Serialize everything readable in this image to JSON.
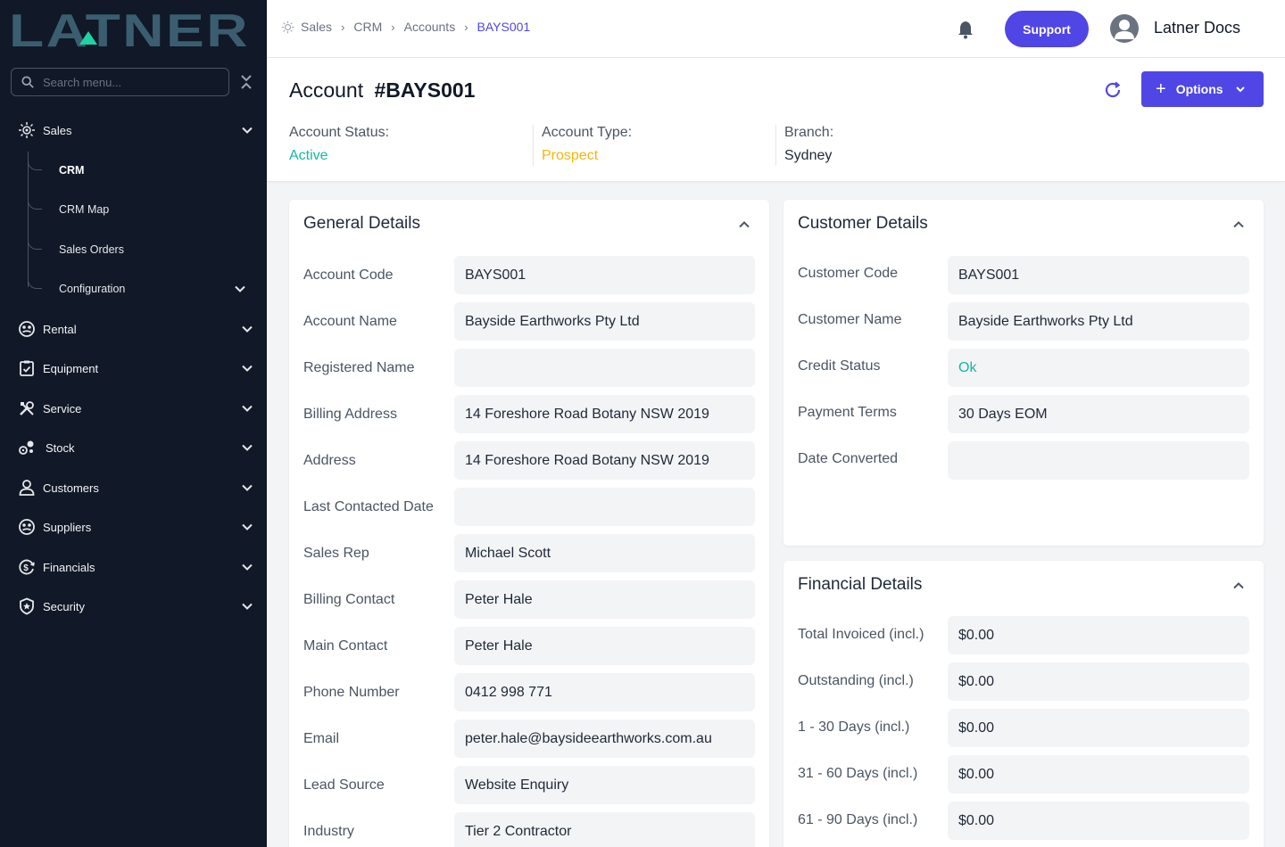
{
  "app": {
    "logo_text": "LATNER",
    "search_placeholder": "Search menu..."
  },
  "colors": {
    "accent": "#4f46e5",
    "active": "#14b8a6",
    "prospect": "#f5b50a",
    "sidebar_bg": "#111827"
  },
  "sidebar": {
    "sales": {
      "label": "Sales",
      "icon": "sales-icon"
    },
    "sales_sub": [
      {
        "label": "CRM",
        "active": true
      },
      {
        "label": "CRM Map"
      },
      {
        "label": "Sales Orders"
      },
      {
        "label": "Configuration"
      }
    ],
    "items": [
      {
        "label": "Rental",
        "icon": "rental-icon"
      },
      {
        "label": "Equipment",
        "icon": "clipboard-check-icon"
      },
      {
        "label": "Service",
        "icon": "tools-icon"
      },
      {
        "label": "Stock",
        "icon": "stock-icon"
      },
      {
        "label": "Customers",
        "icon": "user-icon"
      },
      {
        "label": "Suppliers",
        "icon": "suppliers-icon"
      },
      {
        "label": "Financials",
        "icon": "financials-icon"
      },
      {
        "label": "Security",
        "icon": "shield-icon"
      }
    ]
  },
  "header": {
    "breadcrumb": [
      "Sales",
      "CRM",
      "Accounts",
      "BAYS001"
    ],
    "support_label": "Support",
    "user_name": "Latner Docs"
  },
  "account": {
    "title_prefix": "Account",
    "title_id": "#BAYS001",
    "options_label": "Options",
    "status_label": "Account Status:",
    "status_value": "Active",
    "type_label": "Account Type:",
    "type_value": "Prospect",
    "branch_label": "Branch:",
    "branch_value": "Sydney"
  },
  "general_details": {
    "title": "General Details",
    "rows": [
      {
        "label": "Account Code",
        "value": "BAYS001"
      },
      {
        "label": "Account Name",
        "value": "Bayside Earthworks Pty Ltd"
      },
      {
        "label": "Registered Name",
        "value": ""
      },
      {
        "label": "Billing Address",
        "value": "14 Foreshore Road Botany NSW 2019"
      },
      {
        "label": "Address",
        "value": "14 Foreshore Road Botany NSW 2019"
      },
      {
        "label": "Last Contacted Date",
        "value": ""
      },
      {
        "label": "Sales Rep",
        "value": "Michael Scott"
      },
      {
        "label": "Billing Contact",
        "value": "Peter Hale"
      },
      {
        "label": "Main Contact",
        "value": "Peter Hale"
      },
      {
        "label": "Phone Number",
        "value": "0412 998 771"
      },
      {
        "label": "Email",
        "value": "peter.hale@baysideearthworks.com.au"
      },
      {
        "label": "Lead Source",
        "value": "Website Enquiry"
      },
      {
        "label": "Industry",
        "value": "Tier 2 Contractor"
      }
    ]
  },
  "customer_details": {
    "title": "Customer Details",
    "rows": [
      {
        "label": "Customer Code",
        "value": "BAYS001"
      },
      {
        "label": "Customer Name",
        "value": "Bayside Earthworks Pty Ltd"
      },
      {
        "label": "Credit Status",
        "value": "Ok"
      },
      {
        "label": "Payment Terms",
        "value": "30 Days EOM"
      },
      {
        "label": "Date Converted",
        "value": ""
      }
    ]
  },
  "financial_details": {
    "title": "Financial Details",
    "rows": [
      {
        "label": "Total Invoiced (incl.)",
        "value": "$0.00"
      },
      {
        "label": "Outstanding (incl.)",
        "value": "$0.00"
      },
      {
        "label": "1 - 30 Days (incl.)",
        "value": "$0.00"
      },
      {
        "label": "31 - 60 Days (incl.)",
        "value": "$0.00"
      },
      {
        "label": "61 - 90 Days (incl.)",
        "value": "$0.00"
      }
    ]
  }
}
